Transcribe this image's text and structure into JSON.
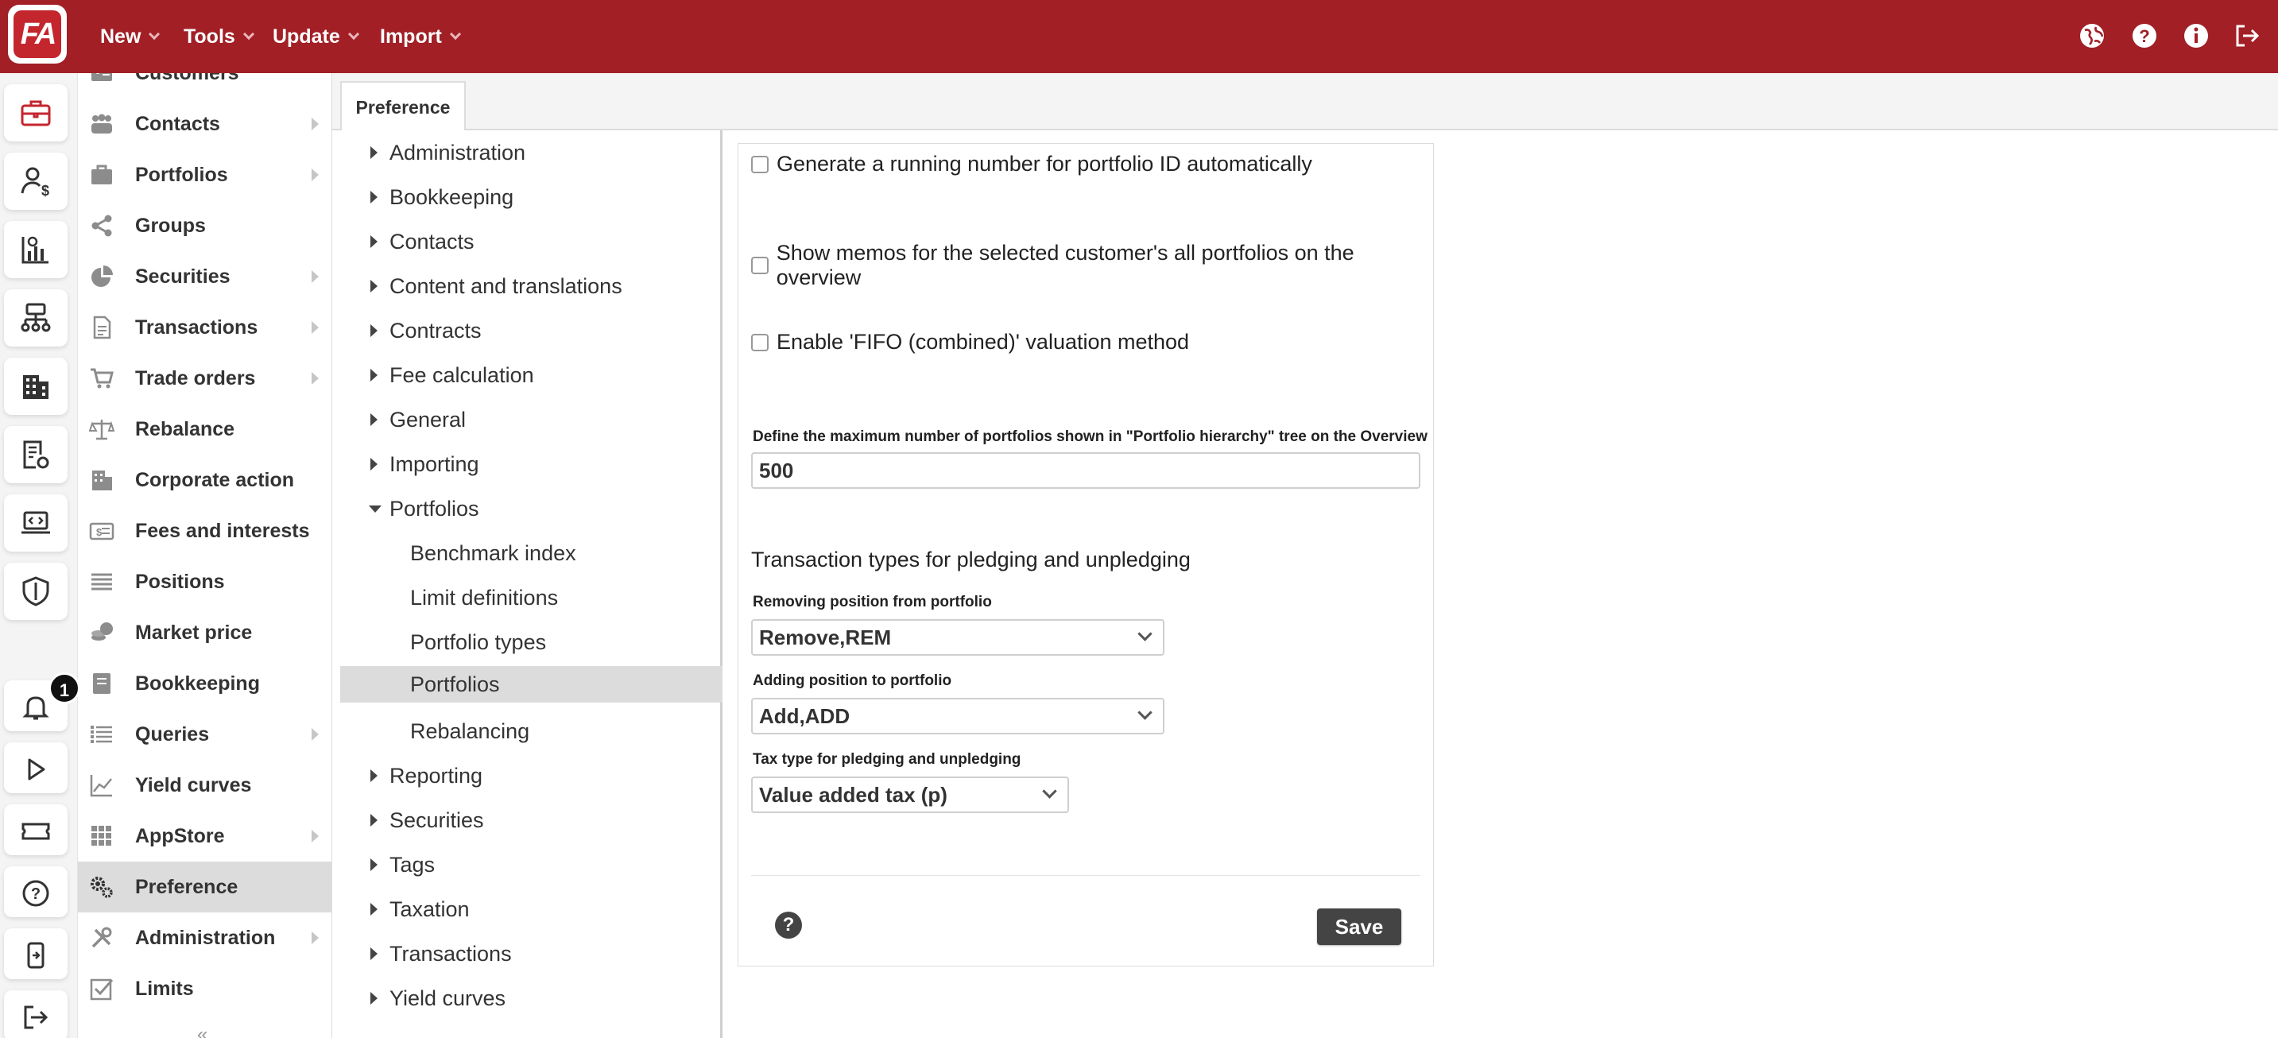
{
  "app": {
    "logo_text": "FA"
  },
  "topbar": {
    "menus": [
      {
        "label": "New"
      },
      {
        "label": "Tools"
      },
      {
        "label": "Update"
      },
      {
        "label": "Import"
      }
    ],
    "icons": [
      "globe-icon",
      "help-circle-icon",
      "info-icon",
      "logout-icon"
    ]
  },
  "rail": {
    "notification_count": "1",
    "icons": [
      "briefcase-icon",
      "user-dollar-icon",
      "analytics-icon",
      "network-icon",
      "building-icon",
      "report-settings-icon",
      "laptop-code-icon",
      "shield-icon",
      "bell-icon",
      "play-icon",
      "ticket-icon",
      "help-icon",
      "mobile-icon",
      "exit-icon"
    ]
  },
  "sidebar": {
    "items": [
      {
        "label": "Customers",
        "has_arrow": false
      },
      {
        "label": "Contacts",
        "has_arrow": true
      },
      {
        "label": "Portfolios",
        "has_arrow": true
      },
      {
        "label": "Groups",
        "has_arrow": false
      },
      {
        "label": "Securities",
        "has_arrow": true
      },
      {
        "label": "Transactions",
        "has_arrow": true
      },
      {
        "label": "Trade orders",
        "has_arrow": true
      },
      {
        "label": "Rebalance",
        "has_arrow": false
      },
      {
        "label": "Corporate action",
        "has_arrow": false
      },
      {
        "label": "Fees and interests",
        "has_arrow": false
      },
      {
        "label": "Positions",
        "has_arrow": false
      },
      {
        "label": "Market price",
        "has_arrow": false
      },
      {
        "label": "Bookkeeping",
        "has_arrow": false
      },
      {
        "label": "Queries",
        "has_arrow": true
      },
      {
        "label": "Yield curves",
        "has_arrow": false
      },
      {
        "label": "AppStore",
        "has_arrow": true
      },
      {
        "label": "Preference",
        "has_arrow": false,
        "active": true
      },
      {
        "label": "Administration",
        "has_arrow": true
      },
      {
        "label": "Limits",
        "has_arrow": false
      }
    ]
  },
  "tabs": [
    {
      "label": "Preference"
    }
  ],
  "tree": {
    "items": [
      {
        "label": "Administration",
        "level": 0
      },
      {
        "label": "Bookkeeping",
        "level": 0
      },
      {
        "label": "Contacts",
        "level": 0
      },
      {
        "label": "Content and translations",
        "level": 0
      },
      {
        "label": "Contracts",
        "level": 0
      },
      {
        "label": "Fee calculation",
        "level": 0
      },
      {
        "label": "General",
        "level": 0
      },
      {
        "label": "Importing",
        "level": 0
      },
      {
        "label": "Portfolios",
        "level": 0,
        "open": true
      },
      {
        "label": "Benchmark index",
        "level": 1
      },
      {
        "label": "Limit definitions",
        "level": 1
      },
      {
        "label": "Portfolio types",
        "level": 1
      },
      {
        "label": "Portfolios",
        "level": 1,
        "active": true
      },
      {
        "label": "Rebalancing",
        "level": 1
      },
      {
        "label": "Reporting",
        "level": 0
      },
      {
        "label": "Securities",
        "level": 0
      },
      {
        "label": "Tags",
        "level": 0
      },
      {
        "label": "Taxation",
        "level": 0
      },
      {
        "label": "Transactions",
        "level": 0
      },
      {
        "label": "Yield curves",
        "level": 0
      }
    ]
  },
  "form": {
    "checkboxes": [
      {
        "label": "Generate a running number for portfolio ID automatically",
        "checked": false
      },
      {
        "label": "Show memos for the selected customer's all portfolios on the overview",
        "checked": false
      },
      {
        "label": "Enable 'FIFO (combined)' valuation method",
        "checked": false
      }
    ],
    "max_portfolios_label": "Define the maximum number of portfolios shown in \"Portfolio hierarchy\" tree on the Overview",
    "max_portfolios_value": "500",
    "pledging_title": "Transaction types for pledging and unpledging",
    "removing_label": "Removing position from portfolio",
    "removing_value": "Remove,REM",
    "adding_label": "Adding position to portfolio",
    "adding_value": "Add,ADD",
    "tax_label": "Tax type for pledging and unpledging",
    "tax_value": "Value added tax (p)",
    "help_symbol": "?",
    "save_label": "Save"
  },
  "colors": {
    "brand": "#a21f26",
    "active_bg": "#dcdcdc",
    "button_dark": "#444444"
  }
}
